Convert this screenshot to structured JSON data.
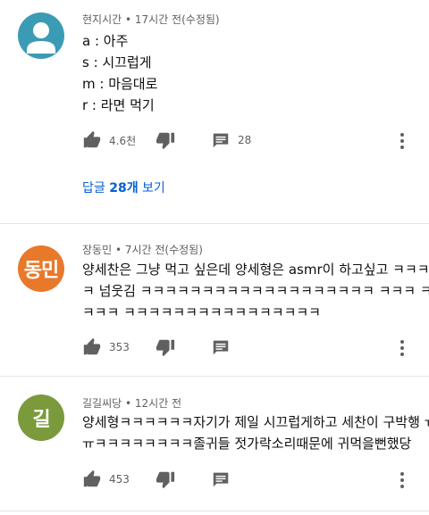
{
  "comments": [
    {
      "author": "현지시간",
      "time": "17시간 전(수정됨)",
      "lines": [
        "a : 아주",
        "s : 시끄럽게",
        "m : 마음대로",
        "r : 라면 먹기"
      ],
      "likes": "4.6천",
      "replies_count": "28",
      "replies_link": "답글 28개 보기",
      "avatar_color": "#3b9bb5"
    },
    {
      "author": "장동민",
      "avatar_text": "동민",
      "time": "7시간 전(수정됨)",
      "lines": [
        "양세찬은 그냥 먹고 싶은데 양세형은 asmr이 하고싶고 ㅋㅋㅋ",
        "ㅋ 넘웃김 ㅋㅋㅋㅋㅋㅋㅋㅋㅋㅋㅋㅋㅋㅋㅋㅋㅋㅋㅋ ㅋㅋㅋ ㅋㅋ",
        "ㅋㅋㅋ ㅋㅋㅋㅋㅋㅋㅋㅋㅋㅋㅋㅋㅋㅋㅋㅋ"
      ],
      "likes": "353",
      "avatar_color": "#e8792b"
    },
    {
      "author": "길길씨당",
      "avatar_text": "길",
      "time": "12시간 전",
      "lines": [
        "양세형ㅋㅋㅋㅋㅋㅋ자기가 제일 시끄럽게하고 세찬이 구박행 ㅠ",
        "ㅠㅋㅋㅋㅋㅋㅋㅋㅋ졸귀들 젓가락소리때문에 귀먹을뻔했당"
      ],
      "likes": "453",
      "avatar_color": "#7a9a3c"
    }
  ],
  "separator": " • ",
  "icons": [
    "thumb-up-icon",
    "thumb-down-icon",
    "reply-icon",
    "more-vert-icon",
    "default-avatar-icon"
  ]
}
